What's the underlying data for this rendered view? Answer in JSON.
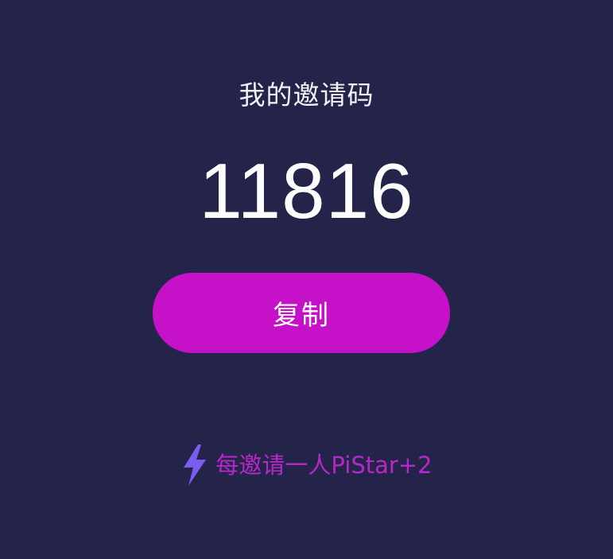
{
  "invite": {
    "title": "我的邀请码",
    "code": "11816"
  },
  "actions": {
    "copy_label": "复制"
  },
  "reward": {
    "icon": "lightning-bolt-icon",
    "text": "每邀请一人PiStar+2"
  },
  "colors": {
    "background": "#24244a",
    "button": "#c512c8",
    "reward_text": "#b428c8",
    "bolt": "#7b5cf0"
  }
}
